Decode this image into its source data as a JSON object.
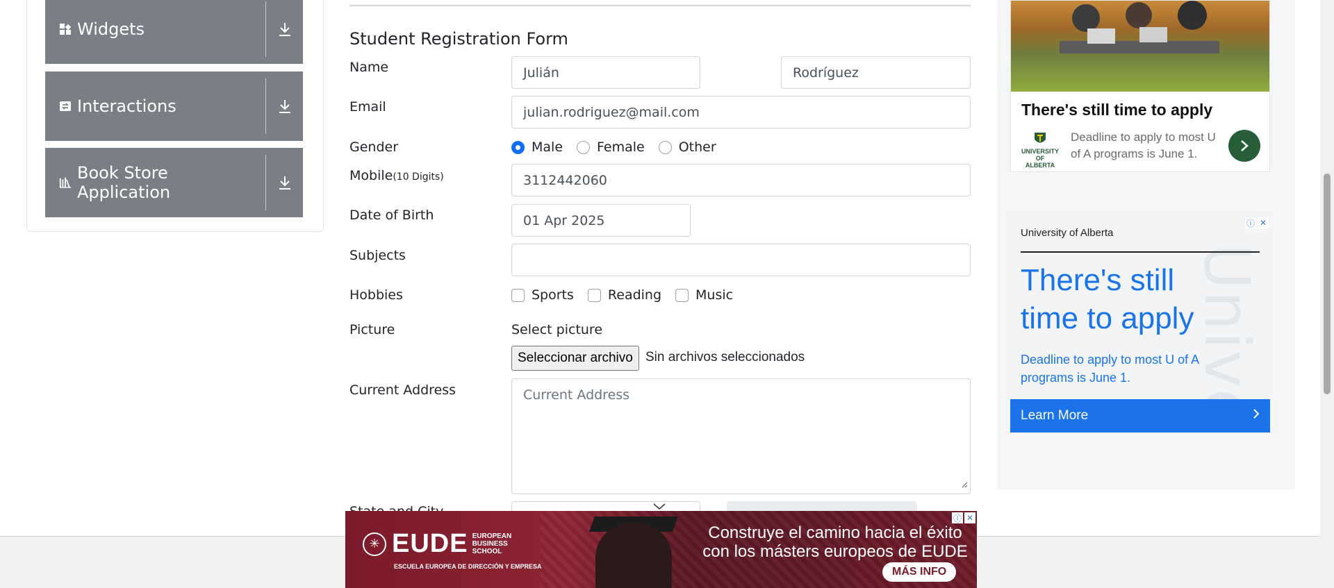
{
  "sidebar": {
    "groups": [
      {
        "label": "Widgets",
        "icon": "widgets-icon"
      },
      {
        "label": "Interactions",
        "icon": "interactions-icon"
      },
      {
        "label": "Book Store Application",
        "icon": "book-store-icon"
      }
    ]
  },
  "form": {
    "title": "Student Registration Form",
    "name_label": "Name",
    "first_name": "Julián",
    "last_name": "Rodríguez",
    "email_label": "Email",
    "email": "julian.rodriguez@mail.com",
    "gender_label": "Gender",
    "genders": [
      "Male",
      "Female",
      "Other"
    ],
    "gender_selected": "Male",
    "mobile_label": "Mobile",
    "mobile_hint": "(10 Digits)",
    "mobile": "3112442060",
    "dob_label": "Date of Birth",
    "dob": "01 Apr 2025",
    "subjects_label": "Subjects",
    "subjects": "",
    "hobbies_label": "Hobbies",
    "hobbies": [
      "Sports",
      "Reading",
      "Music"
    ],
    "picture_label": "Picture",
    "picture_hint": "Select picture",
    "file_button": "Seleccionar archivo",
    "file_status": "Sin archivos seleccionados",
    "address_label": "Current Address",
    "address_placeholder": "Current Address",
    "state_city_label": "State and City"
  },
  "ads": {
    "ad1": {
      "headline": "There's still time to apply",
      "logo_text": "UNIVERSITY OF ALBERTA",
      "body": "Deadline to apply to most U of A programs is June 1."
    },
    "ad2": {
      "brand": "University of Alberta",
      "headline": "There's still time to apply",
      "body": "Deadline to apply to most U of A programs is June 1.",
      "button": "Learn More",
      "watermark": "Unive"
    },
    "banner": {
      "logo_word": "EUDE",
      "logo_side": "EUROPEAN BUSINESS SCHOOL",
      "tagline": "ESCUELA EUROPEA DE DIRECCIÓN Y EMPRESA",
      "message": "Construye el camino hacia el éxito con los másters europeos de EUDE",
      "cta": "MÁS INFO"
    }
  },
  "colors": {
    "sidebar_group_bg": "#7a7f86",
    "accent_blue": "#0d6efd",
    "ad_blue": "#1a73e8",
    "ualberta_green": "#275d38",
    "banner_red": "#7b1a2a"
  }
}
